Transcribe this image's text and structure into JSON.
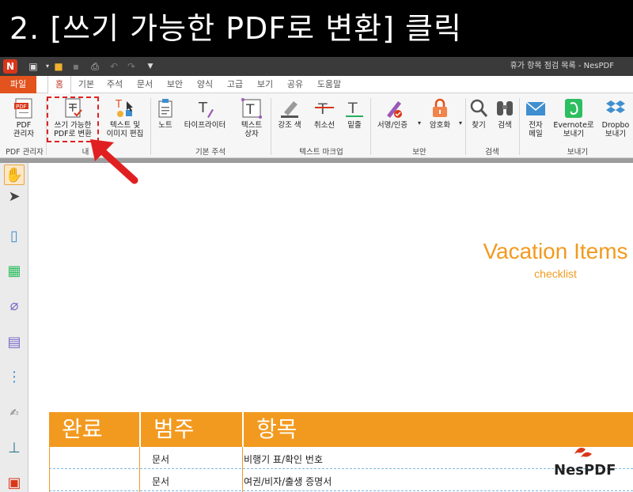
{
  "banner": {
    "text": "2. [쓰기 가능한 PDF로 변환] 클릭"
  },
  "window": {
    "title": "휴가 항목 점검 목록 - NesPDF"
  },
  "menu": {
    "file": "파일",
    "tabs": [
      "홈",
      "기본",
      "주석",
      "문서",
      "보안",
      "양식",
      "고급",
      "보기",
      "공유",
      "도움말"
    ]
  },
  "ribbon": {
    "pdf_manager": "PDF\n관리자",
    "convert": "쓰기 가능한\nPDF로 변환",
    "edit_text_image": "텍스트 및\n이미지 편집",
    "note": "노트",
    "typewriter": "타이프라이터",
    "textbox": "텍스트\n상자",
    "highlight": "강조 색",
    "strikeout": "취소선",
    "underline": "밑줄",
    "sign": "서명/인증",
    "encrypt": "암호화",
    "find": "찾기",
    "search": "검색",
    "email": "전자\n메일",
    "evernote": "Evernote로\n보내기",
    "dropbox": "Dropbo\n보내기",
    "groups": {
      "pdf_manager": "PDF 관리자",
      "content": "내",
      "basic_annot": "기본 주석",
      "text_markup": "텍스트 마크업",
      "security": "보안",
      "search": "검색",
      "send": "보내기"
    }
  },
  "document": {
    "title": "Vacation Items",
    "subtitle": "checklist",
    "table": {
      "headers": [
        "완료",
        "범주",
        "항목"
      ],
      "rows": [
        [
          "",
          "문서",
          "비행기 표/확인 번호"
        ],
        [
          "",
          "문서",
          "여권/비자/출생 증명서"
        ]
      ]
    },
    "logo": "NesPDF"
  },
  "colors": {
    "accent": "#f29a1f",
    "file_tab": "#e2531d",
    "highlight_border": "#e02020"
  }
}
